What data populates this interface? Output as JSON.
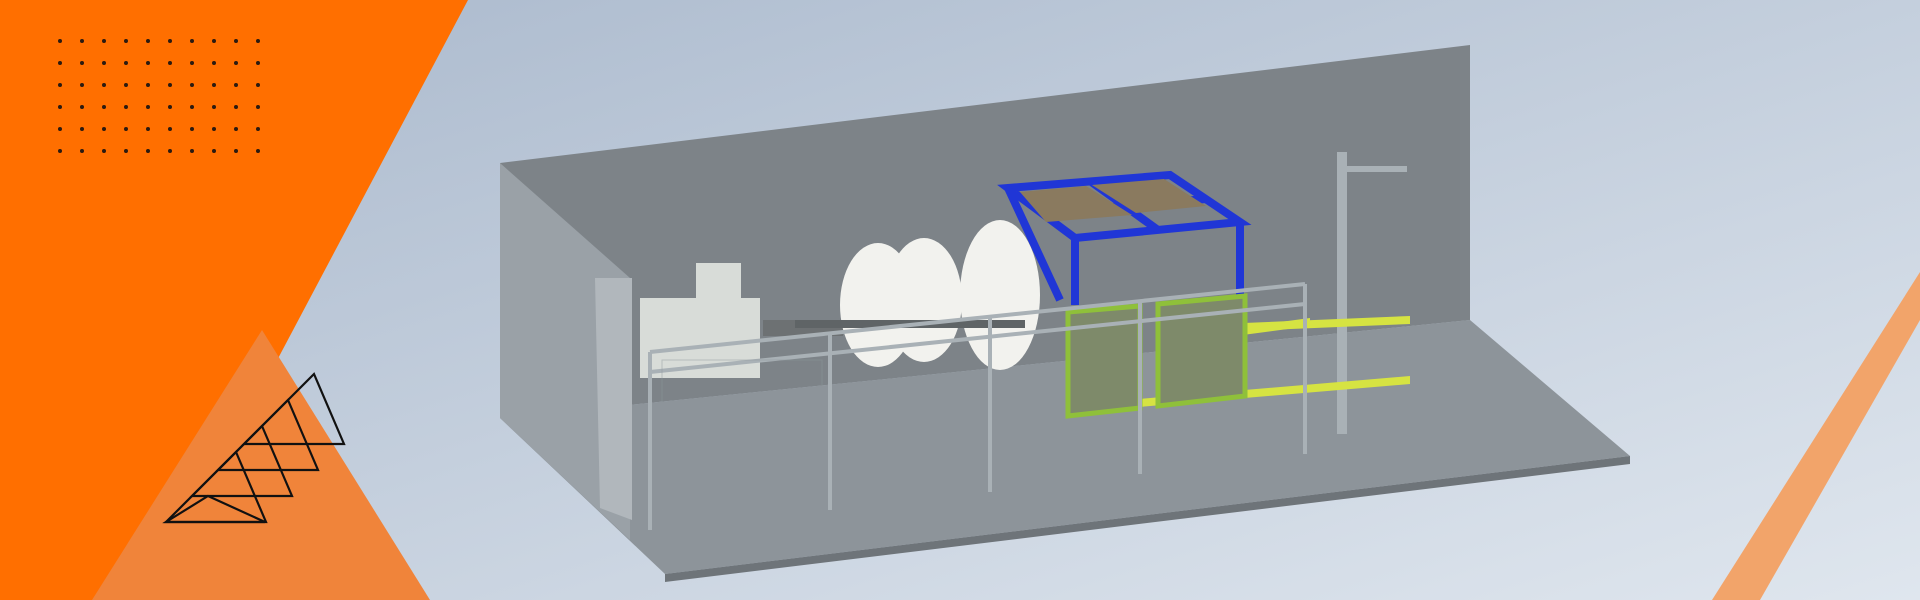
{
  "banner": {
    "background_gradient": [
      "#a9b8cc",
      "#dfe6ee"
    ],
    "accent_primary": "#ff6f00",
    "accent_secondary": "#f0843a",
    "accent_soft": "#f2a46a",
    "dot_color": "#2b1a10",
    "chevron_color": "#111111"
  },
  "scene": {
    "room_wall_color": "#7d8388",
    "room_floor_color": "#8d949a",
    "room_side_color": "#9aa1a7",
    "frame_color": "#2036d6",
    "rail_color": "#d6e342",
    "panel_color": "#7e8a6a",
    "panel_border_color": "#8fc03a",
    "pulley_color": "#f2f2ee",
    "machine_color": "#d8dcd8",
    "fence_color": "#a9b1b6"
  }
}
